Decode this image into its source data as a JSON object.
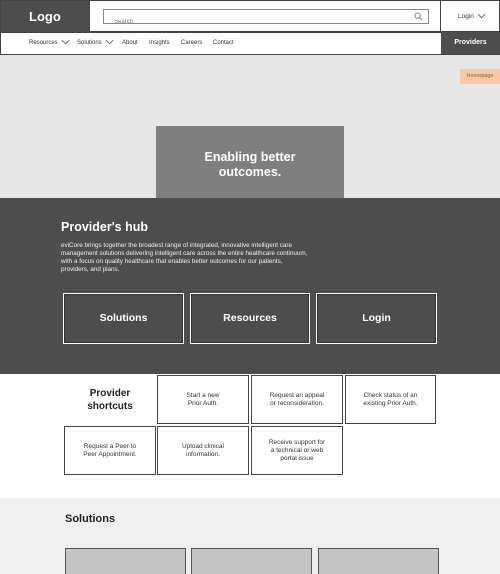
{
  "header": {
    "logo": "Logo",
    "search_placeholder": "Search",
    "login": "Login"
  },
  "nav": {
    "items": [
      "Resources",
      "Solutions",
      "About",
      "Insights",
      "Careers",
      "Contact"
    ],
    "providers": "Providers"
  },
  "hero": {
    "tag": "Homepage",
    "headline_line1": "Enabling better",
    "headline_line2": "outcomes."
  },
  "hub": {
    "title": "Provider's hub",
    "description": "eviCore brings together the broadest range of integrated, innovative intelligent care management solutions delivering intelligent care across the entire healthcare continuum, with a focus on quality healthcare that enables better outcomes for our patients, providers, and plans.",
    "buttons": [
      "Solutions",
      "Resources",
      "Login"
    ]
  },
  "shortcuts": {
    "title_line1": "Provider",
    "title_line2": "shortcuts",
    "cards": [
      [
        "Start a new",
        "Prior Auth."
      ],
      [
        "Request an appeal",
        "or reconsideration."
      ],
      [
        "Check status of an",
        "existing Prior Auth."
      ],
      [
        "Request a Peer to",
        "Peer Appointment."
      ],
      [
        "Upload clinical",
        "information."
      ],
      [
        "Receive support for",
        "a technical or web",
        "portal issue"
      ]
    ]
  },
  "solutions": {
    "title": "Solutions"
  }
}
